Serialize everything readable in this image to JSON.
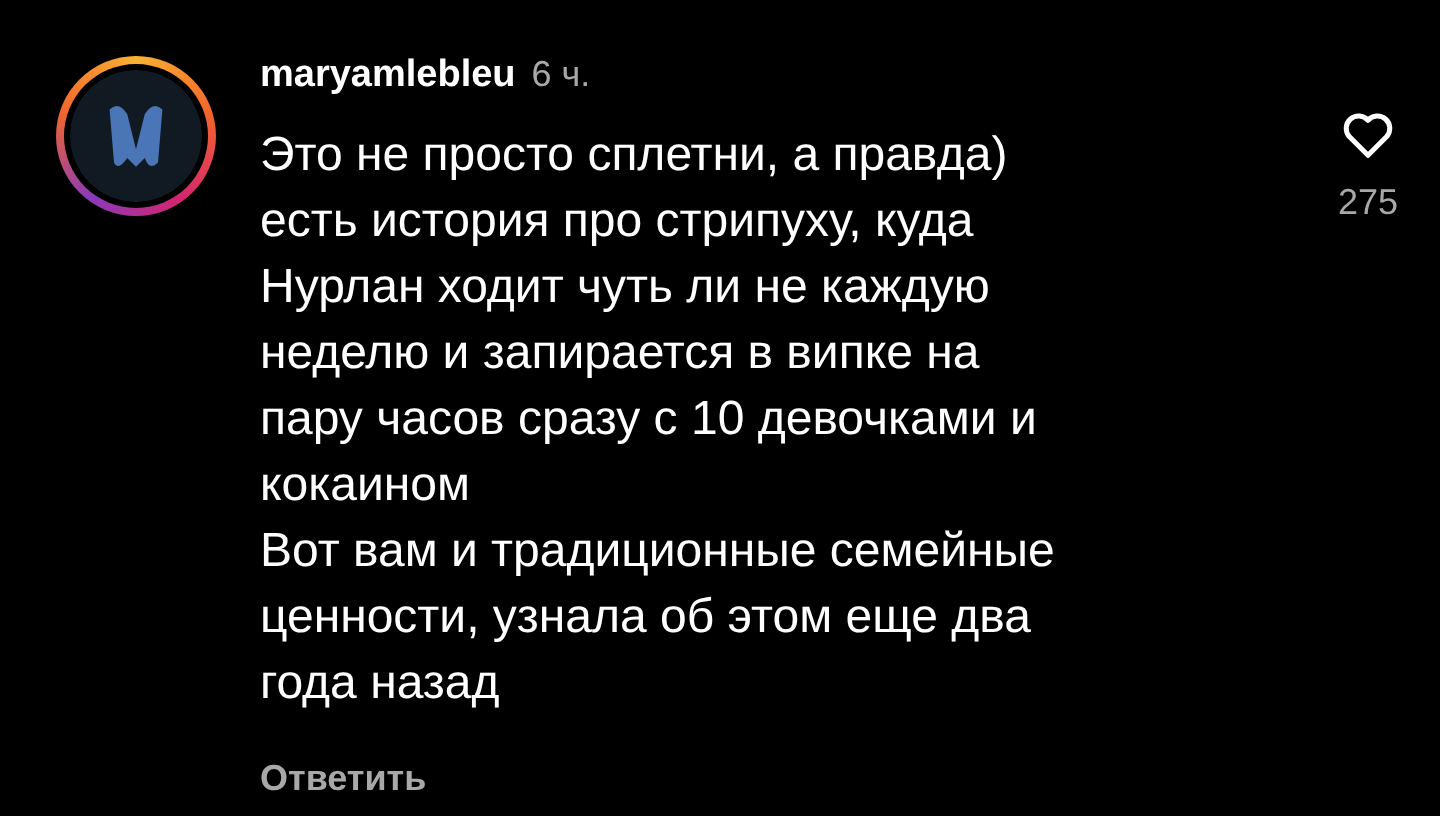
{
  "comment": {
    "username": "maryamlebleu",
    "time": "6 ч.",
    "lines": [
      "Это не просто сплетни, а правда)",
      "есть история про стрипуху, куда",
      "Нурлан ходит чуть ли не каждую",
      "неделю и запирается в випке на",
      "пару часов сразу с 10 девочками и",
      "кокаином",
      "Вот вам и традиционные семейные",
      "ценности, узнала об этом еще два",
      "года назад"
    ],
    "likes": "275",
    "liked": false,
    "reply": "Ответить"
  }
}
